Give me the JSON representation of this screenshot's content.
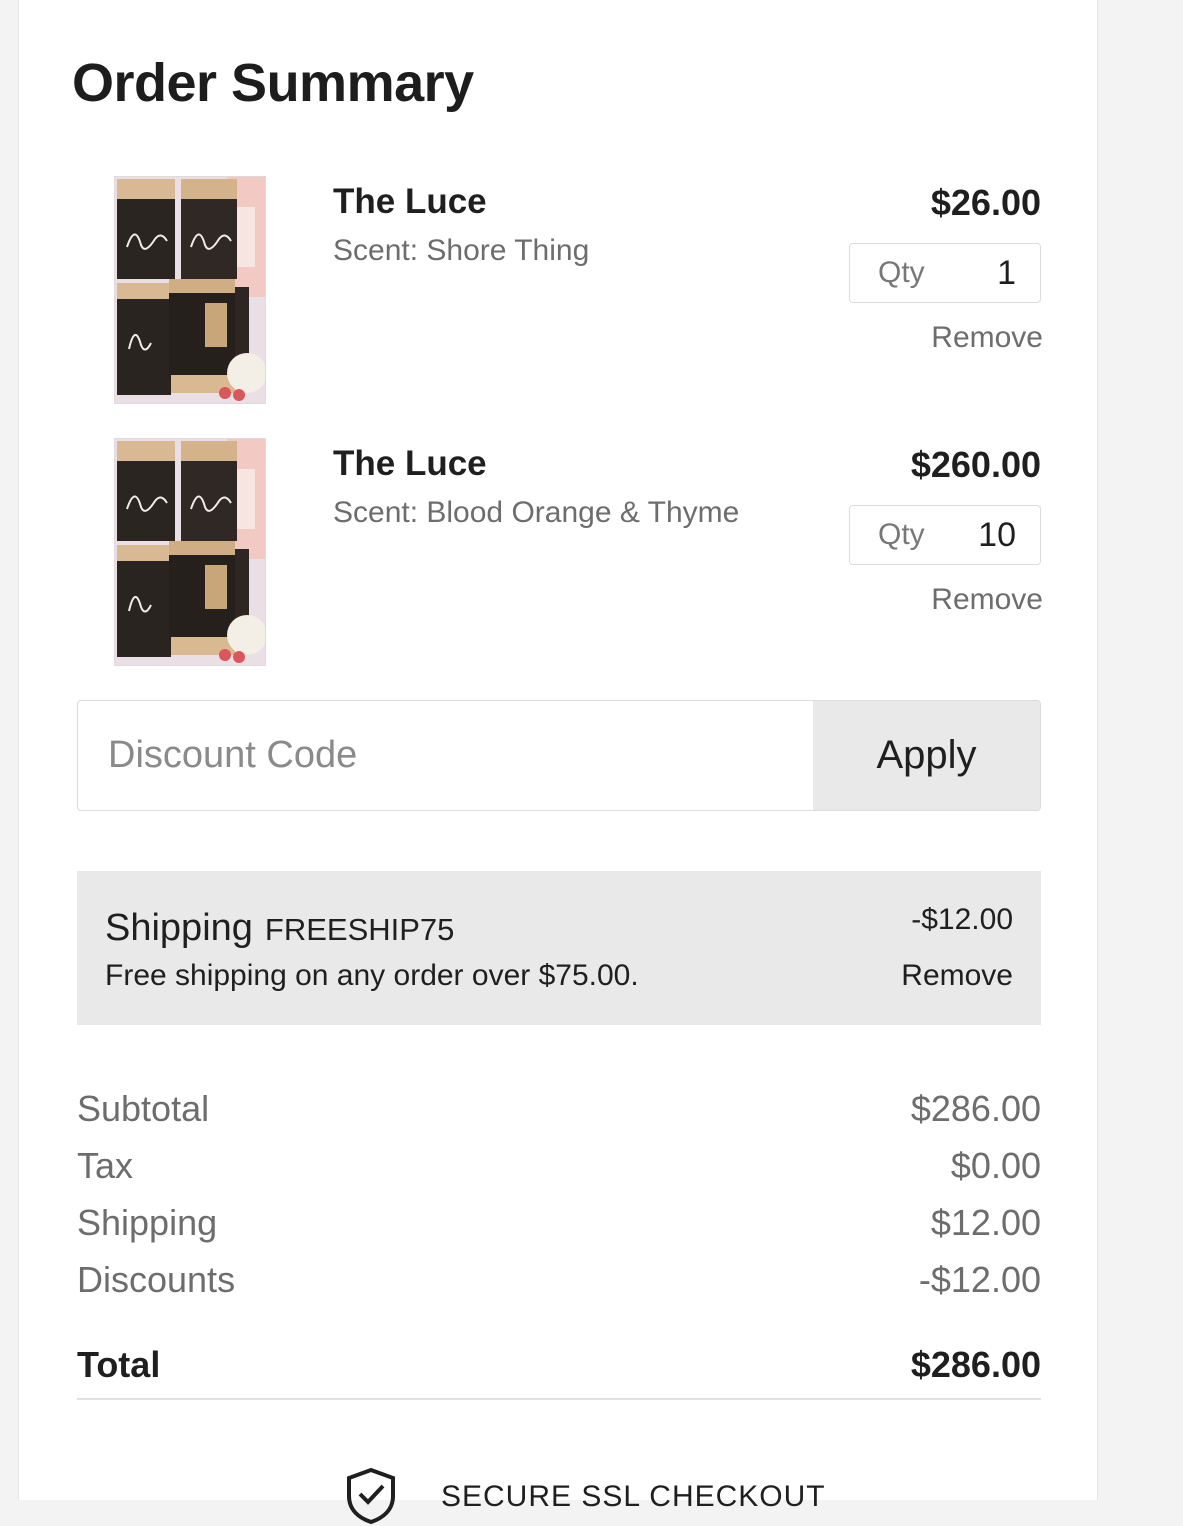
{
  "header": {
    "title": "Order Summary"
  },
  "items": [
    {
      "name": "The Luce",
      "variant": "Scent: Shore Thing",
      "price": "$26.00",
      "qty_label": "Qty",
      "qty": "1",
      "remove_label": "Remove"
    },
    {
      "name": "The Luce",
      "variant": "Scent: Blood Orange & Thyme",
      "price": "$260.00",
      "qty_label": "Qty",
      "qty": "10",
      "remove_label": "Remove"
    }
  ],
  "discount": {
    "placeholder": "Discount Code",
    "apply_label": "Apply"
  },
  "promo": {
    "type": "Shipping",
    "code": "FREESHIP75",
    "description": "Free shipping on any order over $75.00.",
    "amount": "-$12.00",
    "remove_label": "Remove"
  },
  "totals": {
    "subtotal": {
      "label": "Subtotal",
      "value": "$286.00"
    },
    "tax": {
      "label": "Tax",
      "value": "$0.00"
    },
    "shipping": {
      "label": "Shipping",
      "value": "$12.00"
    },
    "discounts": {
      "label": "Discounts",
      "value": "-$12.00"
    },
    "total": {
      "label": "Total",
      "value": "$286.00"
    }
  },
  "footer": {
    "secure_label": "SECURE SSL CHECKOUT",
    "secure_icon": "shield-check-icon"
  }
}
